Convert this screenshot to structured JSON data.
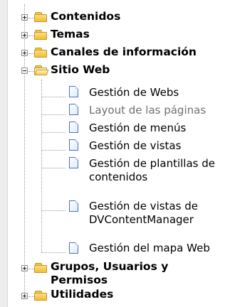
{
  "tree": {
    "top_folders": [
      {
        "label": "Contenidos",
        "expanded": false
      },
      {
        "label": "Temas",
        "expanded": false
      },
      {
        "label": "Canales de información",
        "expanded": false
      }
    ],
    "site_folder": {
      "label": "Sitio Web",
      "expanded": true,
      "children": [
        {
          "label": "Gestión de Webs",
          "lines": [
            "Gestión de Webs"
          ],
          "disabled": false
        },
        {
          "label": "Layout de las páginas",
          "lines": [
            "Layout de las páginas"
          ],
          "disabled": true
        },
        {
          "label": "Gestión de menús",
          "lines": [
            "Gestión de menús"
          ],
          "disabled": false
        },
        {
          "label": "Gestión de vistas",
          "lines": [
            "Gestión de vistas"
          ],
          "disabled": false
        },
        {
          "label": "Gestión de plantillas de contenidos",
          "lines": [
            "Gestión de plantillas de",
            "contenidos"
          ],
          "disabled": false
        },
        {
          "label": "Gestión de vistas de DVContentManager",
          "lines": [
            "Gestión de vistas de",
            "DVContentManager"
          ],
          "disabled": false
        },
        {
          "label": "Gestión del mapa Web",
          "lines": [
            "Gestión del mapa Web"
          ],
          "disabled": false
        }
      ]
    },
    "bottom_folders": [
      {
        "label": "Grupos, Usuarios y Permisos",
        "lines": [
          "Grupos, Usuarios y",
          "Permisos"
        ],
        "expanded": false
      },
      {
        "label": "Utilidades",
        "lines": [
          "Utilidades"
        ],
        "expanded": false
      }
    ]
  }
}
